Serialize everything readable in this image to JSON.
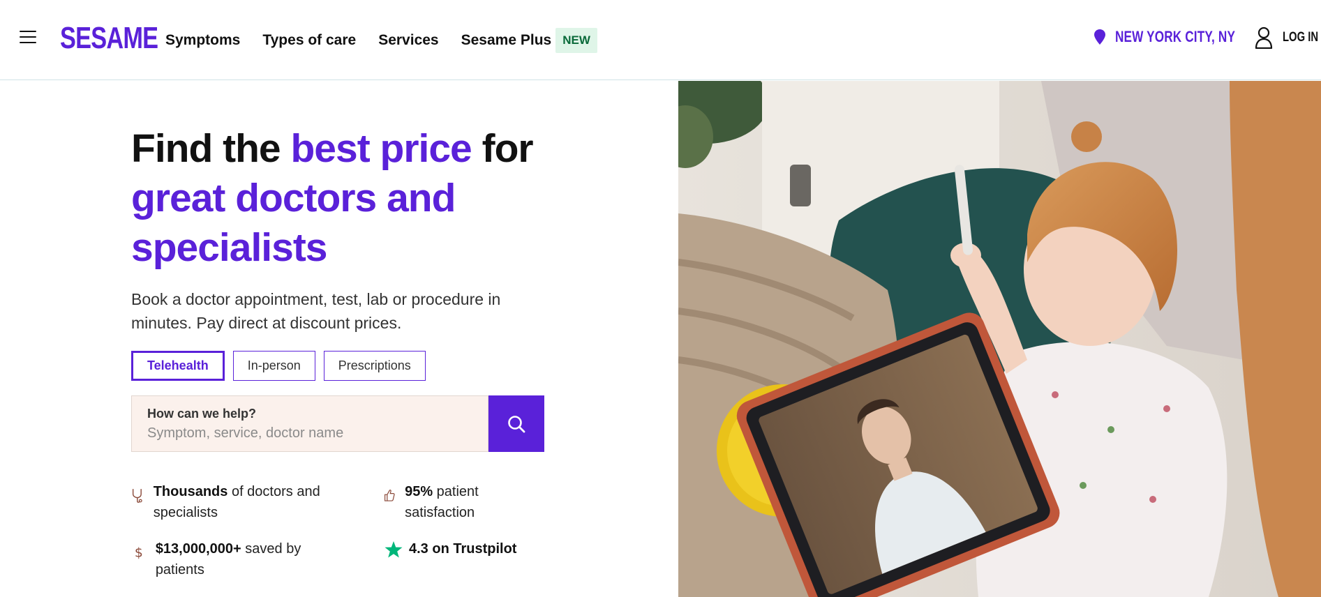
{
  "header": {
    "logo": "SESAME",
    "nav": [
      {
        "label": "Symptoms"
      },
      {
        "label": "Types of care"
      },
      {
        "label": "Services"
      },
      {
        "label": "Sesame Plus"
      }
    ],
    "new_badge": "NEW",
    "location": "NEW YORK CITY, NY",
    "login": "LOG IN"
  },
  "hero": {
    "headline_1": "Find the ",
    "headline_accent_1": "best price",
    "headline_2": " for",
    "headline_accent_2": "great doctors and specialists",
    "subtitle": "Book a doctor appointment, test, lab or procedure in minutes. Pay direct at discount prices.",
    "tabs": [
      {
        "label": "Telehealth",
        "active": true
      },
      {
        "label": "In-person",
        "active": false
      },
      {
        "label": "Prescriptions",
        "active": false
      }
    ],
    "search": {
      "label": "How can we help?",
      "placeholder": "Symptom, service, doctor name"
    }
  },
  "stats": [
    {
      "strong": "Thousands",
      "rest": " of doctors and specialists",
      "icon": "stethoscope-icon"
    },
    {
      "strong": "95%",
      "rest": " patient satisfaction",
      "icon": "thumbs-up-icon"
    },
    {
      "strong": "$13,000,000+",
      "rest": " saved by patients",
      "icon": "dollar-icon"
    },
    {
      "strong": "4.3 on",
      "rest": " Trustpilot",
      "icon": "star-icon"
    }
  ],
  "colors": {
    "brand": "#5a21d9",
    "new_badge_bg": "#dff5e8",
    "search_bg": "#fbf1ec",
    "trustpilot_green": "#00b67a"
  }
}
